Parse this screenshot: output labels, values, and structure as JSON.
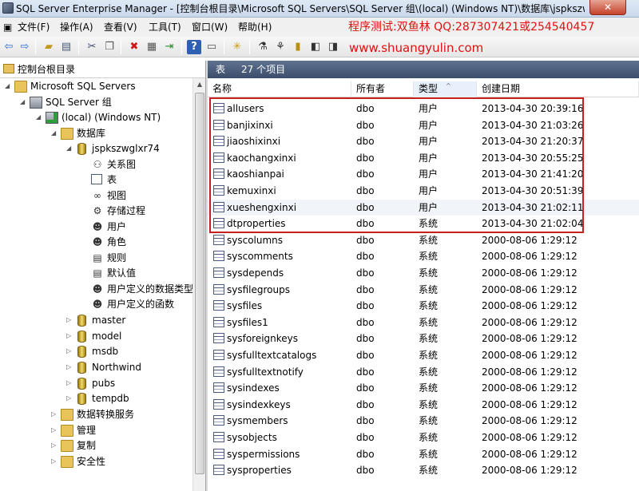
{
  "window": {
    "title": "SQL Server Enterprise Manager - [控制台根目录\\Microsoft SQL Servers\\SQL Server 组\\(local) (Windows NT)\\数据库\\jspkszwglx...",
    "close_glyph": "✕"
  },
  "menu": {
    "items": [
      {
        "label": "文件(F)"
      },
      {
        "label": "操作(A)"
      },
      {
        "label": "查看(V)"
      },
      {
        "label": "工具(T)"
      },
      {
        "label": "窗口(W)"
      },
      {
        "label": "帮助(H)"
      }
    ]
  },
  "overlay": {
    "promo_text": "程序测试:双鱼林 QQ:287307421或254540457",
    "promo_url": "www.shuangyulin.com",
    "accent_color": "#e01010"
  },
  "toolbar": {
    "icons": [
      "back-icon",
      "forward-icon",
      "up-folder-icon",
      "show-tree-icon",
      "cut-icon",
      "copy-icon",
      "delete-icon",
      "properties-icon",
      "export-icon",
      "help-icon",
      "new-icon",
      "wizard-icon",
      "database-icon",
      "tool-icon",
      "register-server-icon"
    ]
  },
  "tree": {
    "root_label": "控制台根目录",
    "nodes": [
      {
        "label": "Microsoft SQL Servers"
      },
      {
        "label": "SQL Server 组"
      },
      {
        "label": "(local) (Windows NT)"
      },
      {
        "label": "数据库"
      },
      {
        "label": "jspkszwglxr74"
      },
      {
        "label": "关系图"
      },
      {
        "label": "表"
      },
      {
        "label": "视图"
      },
      {
        "label": "存储过程"
      },
      {
        "label": "用户"
      },
      {
        "label": "角色"
      },
      {
        "label": "规则"
      },
      {
        "label": "默认值"
      },
      {
        "label": "用户定义的数据类型"
      },
      {
        "label": "用户定义的函数"
      },
      {
        "label": "master"
      },
      {
        "label": "model"
      },
      {
        "label": "msdb"
      },
      {
        "label": "Northwind"
      },
      {
        "label": "pubs"
      },
      {
        "label": "tempdb"
      },
      {
        "label": "数据转换服务"
      },
      {
        "label": "管理"
      },
      {
        "label": "复制"
      },
      {
        "label": "安全性"
      }
    ]
  },
  "list": {
    "header_title": "表",
    "item_count": "27 个项目",
    "columns": [
      "名称",
      "所有者",
      "类型",
      "创建日期"
    ],
    "rows": [
      {
        "name": "allusers",
        "owner": "dbo",
        "type": "用户",
        "created": "2013-04-30 20:39:16"
      },
      {
        "name": "banjixinxi",
        "owner": "dbo",
        "type": "用户",
        "created": "2013-04-30 21:03:26"
      },
      {
        "name": "jiaoshixinxi",
        "owner": "dbo",
        "type": "用户",
        "created": "2013-04-30 21:20:37"
      },
      {
        "name": "kaochangxinxi",
        "owner": "dbo",
        "type": "用户",
        "created": "2013-04-30 20:55:25"
      },
      {
        "name": "kaoshianpai",
        "owner": "dbo",
        "type": "用户",
        "created": "2013-04-30 21:41:20"
      },
      {
        "name": "kemuxinxi",
        "owner": "dbo",
        "type": "用户",
        "created": "2013-04-30 20:51:39"
      },
      {
        "name": "xueshengxinxi",
        "owner": "dbo",
        "type": "用户",
        "created": "2013-04-30 21:02:11"
      },
      {
        "name": "dtproperties",
        "owner": "dbo",
        "type": "系统",
        "created": "2013-04-30 21:02:04"
      },
      {
        "name": "syscolumns",
        "owner": "dbo",
        "type": "系统",
        "created": "2000-08-06 1:29:12"
      },
      {
        "name": "syscomments",
        "owner": "dbo",
        "type": "系统",
        "created": "2000-08-06 1:29:12"
      },
      {
        "name": "sysdepends",
        "owner": "dbo",
        "type": "系统",
        "created": "2000-08-06 1:29:12"
      },
      {
        "name": "sysfilegroups",
        "owner": "dbo",
        "type": "系统",
        "created": "2000-08-06 1:29:12"
      },
      {
        "name": "sysfiles",
        "owner": "dbo",
        "type": "系统",
        "created": "2000-08-06 1:29:12"
      },
      {
        "name": "sysfiles1",
        "owner": "dbo",
        "type": "系统",
        "created": "2000-08-06 1:29:12"
      },
      {
        "name": "sysforeignkeys",
        "owner": "dbo",
        "type": "系统",
        "created": "2000-08-06 1:29:12"
      },
      {
        "name": "sysfulltextcatalogs",
        "owner": "dbo",
        "type": "系统",
        "created": "2000-08-06 1:29:12"
      },
      {
        "name": "sysfulltextnotify",
        "owner": "dbo",
        "type": "系统",
        "created": "2000-08-06 1:29:12"
      },
      {
        "name": "sysindexes",
        "owner": "dbo",
        "type": "系统",
        "created": "2000-08-06 1:29:12"
      },
      {
        "name": "sysindexkeys",
        "owner": "dbo",
        "type": "系统",
        "created": "2000-08-06 1:29:12"
      },
      {
        "name": "sysmembers",
        "owner": "dbo",
        "type": "系统",
        "created": "2000-08-06 1:29:12"
      },
      {
        "name": "sysobjects",
        "owner": "dbo",
        "type": "系统",
        "created": "2000-08-06 1:29:12"
      },
      {
        "name": "syspermissions",
        "owner": "dbo",
        "type": "系统",
        "created": "2000-08-06 1:29:12"
      },
      {
        "name": "sysproperties",
        "owner": "dbo",
        "type": "系统",
        "created": "2000-08-06 1:29:12"
      }
    ]
  }
}
